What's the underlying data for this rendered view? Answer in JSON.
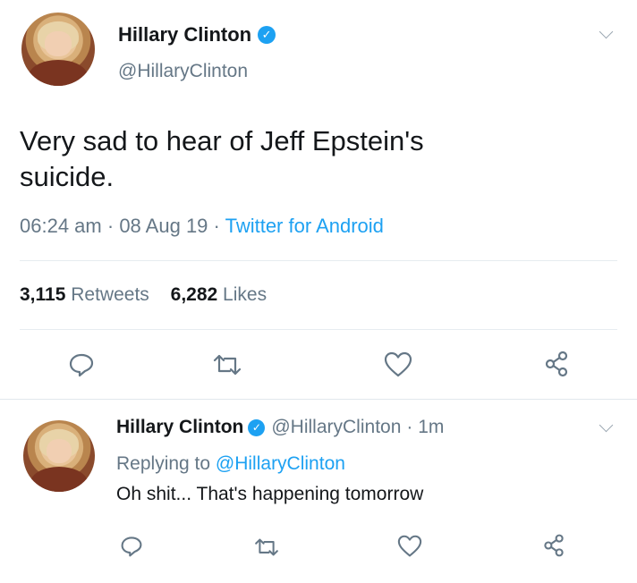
{
  "main_tweet": {
    "name": "Hillary Clinton",
    "handle": "@HillaryClinton",
    "text_line1": "Very sad to hear of Jeff Epstein's",
    "text_line2": "suicide.",
    "time": "06:24 am",
    "date": "08 Aug 19",
    "separator": "·",
    "source": "Twitter for Android",
    "retweets_count": "3,115",
    "retweets_label": "Retweets",
    "likes_count": "6,282",
    "likes_label": "Likes"
  },
  "reply_tweet": {
    "name": "Hillary Clinton",
    "handle": "@HillaryClinton",
    "age": "· 1m",
    "replying_prefix": "Replying to",
    "replying_to": "@HillaryClinton",
    "text": "Oh shit... That's happening tomorrow"
  },
  "icons": [
    "reply-icon",
    "retweet-icon",
    "like-icon",
    "share-icon",
    "chevron-down-icon",
    "verified-icon"
  ],
  "colors": {
    "accent": "#1da1f2",
    "text": "#14171a",
    "muted": "#657786",
    "divider": "#e6ecf0"
  }
}
